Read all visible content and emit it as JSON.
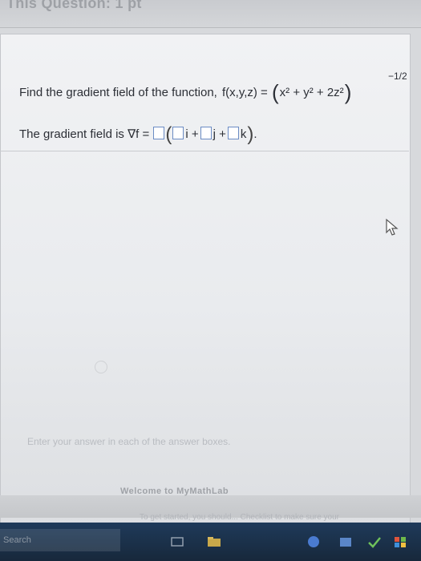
{
  "header": {
    "title": "This Question: 1 pt"
  },
  "question": {
    "prompt": "Find the gradient field of the function,",
    "function_lhs": "f(x,y,z) =",
    "base_terms": "x² + y² + 2z²",
    "exponent": "−1/2"
  },
  "answer": {
    "label": "The gradient field is ∇f =",
    "unit_i": "i +",
    "unit_j": "j +",
    "unit_k": "k",
    "end": "."
  },
  "hint": "Enter your answer in each of the answer boxes.",
  "footer": {
    "welcome": "Welcome to MyMathLab",
    "started": "To get started, you should... Checklist to make sure your"
  },
  "taskbar": {
    "search_placeholder": "Search"
  },
  "colors": {
    "box_border": "#6b8cc4",
    "taskbar": "#1f3a5a"
  }
}
